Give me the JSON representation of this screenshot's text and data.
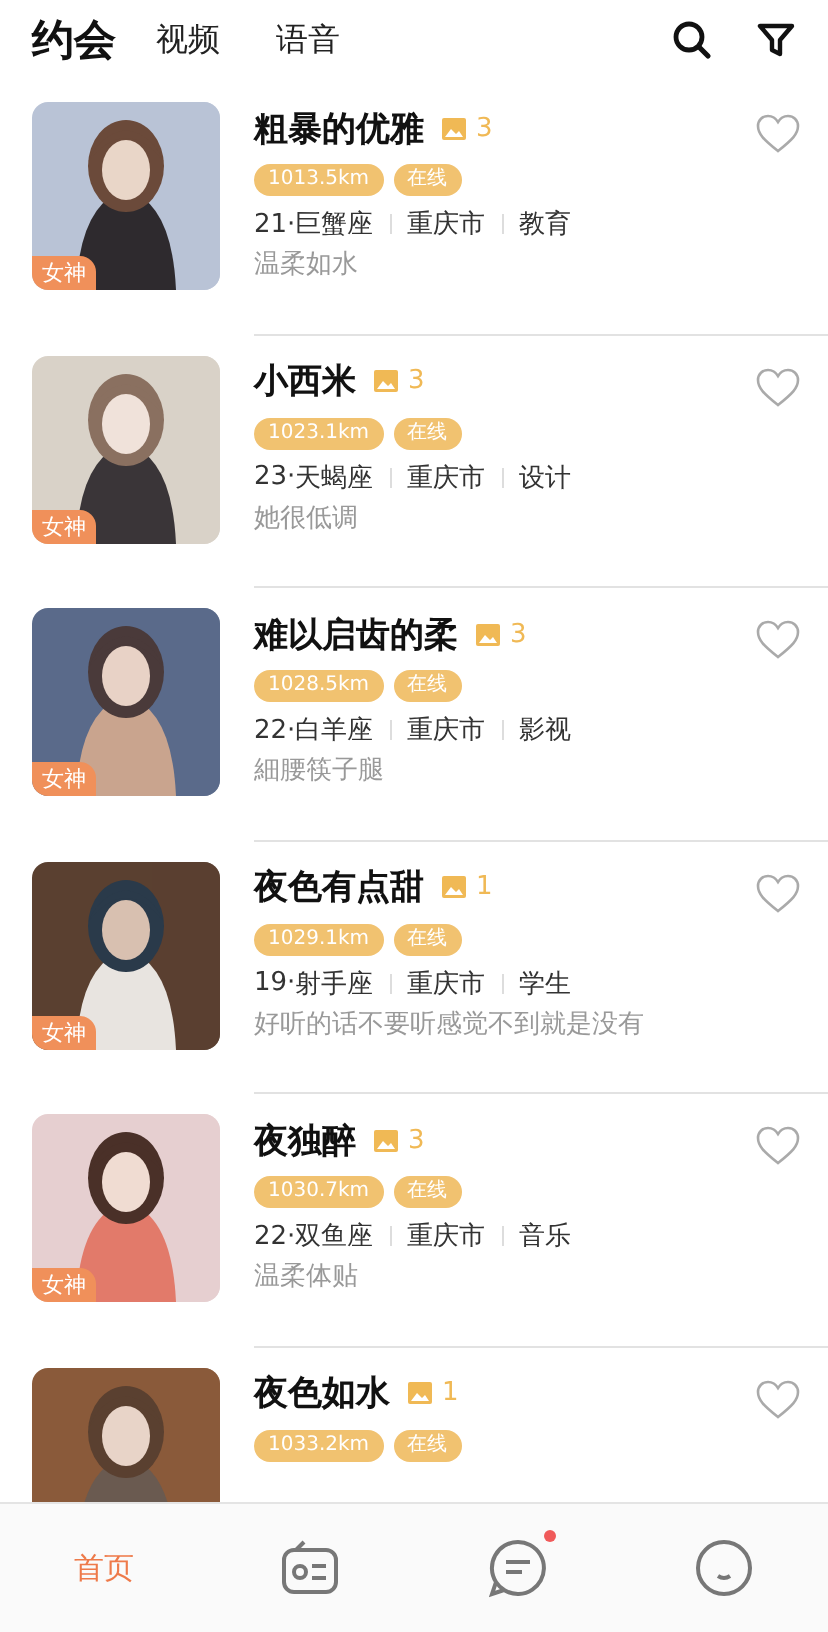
{
  "tabs": [
    {
      "label": "约会",
      "selected": true
    },
    {
      "label": "视频",
      "selected": false
    },
    {
      "label": "语音",
      "selected": false
    }
  ],
  "users": [
    {
      "name": "粗暴的优雅",
      "photos": "3",
      "badge": "女神",
      "distance": "1013.5km",
      "status": "在线",
      "age": "21·",
      "zodiac": "巨蟹座",
      "city": "重庆市",
      "job": "教育",
      "bio": "温柔如水",
      "liked": false
    },
    {
      "name": "小西米",
      "photos": "3",
      "badge": "女神",
      "distance": "1023.1km",
      "status": "在线",
      "age": "23·",
      "zodiac": "天蝎座",
      "city": "重庆市",
      "job": "设计",
      "bio": "她很低调",
      "liked": false
    },
    {
      "name": "难以启齿的柔",
      "photos": "3",
      "badge": "女神",
      "distance": "1028.5km",
      "status": "在线",
      "age": "22·",
      "zodiac": "白羊座",
      "city": "重庆市",
      "job": "影视",
      "bio": "細腰筷子腿",
      "liked": false
    },
    {
      "name": "夜色有点甜",
      "photos": "1",
      "badge": "女神",
      "distance": "1029.1km",
      "status": "在线",
      "age": "19·",
      "zodiac": "射手座",
      "city": "重庆市",
      "job": "学生",
      "bio": "好听的话不要听感觉不到就是没有",
      "liked": false
    },
    {
      "name": "夜独醉",
      "photos": "3",
      "badge": "女神",
      "distance": "1030.7km",
      "status": "在线",
      "age": "22·",
      "zodiac": "双鱼座",
      "city": "重庆市",
      "job": "音乐",
      "bio": "温柔体贴",
      "liked": false
    },
    {
      "name": "夜色如水",
      "photos": "1",
      "distance": "1033.2km",
      "status": "在线",
      "liked": false
    }
  ],
  "nav": [
    {
      "label": "首页",
      "selected": true,
      "dot": false
    },
    {
      "selected": false,
      "dot": false
    },
    {
      "selected": false,
      "dot": true
    },
    {
      "selected": false,
      "dot": false
    }
  ]
}
